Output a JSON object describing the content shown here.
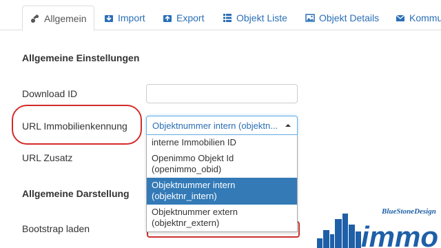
{
  "tabs": [
    {
      "label": "Allgemein",
      "icon": "wrench-icon"
    },
    {
      "label": "Import",
      "icon": "import-icon"
    },
    {
      "label": "Export",
      "icon": "export-icon"
    },
    {
      "label": "Objekt Liste",
      "icon": "list-icon"
    },
    {
      "label": "Objekt Details",
      "icon": "picture-icon"
    },
    {
      "label": "Kommu",
      "icon": "envelope-icon"
    }
  ],
  "sections": {
    "general_settings": "Allgemeine Einstellungen",
    "general_display": "Allgemeine Darstellung"
  },
  "fields": {
    "download_id_label": "Download ID",
    "download_id_value": "",
    "url_label": "URL Immobilienkennung",
    "url_selected": "Objektnummer intern (objektn...",
    "url_suffix_label": "URL Zusatz",
    "bootstrap_label": "Bootstrap laden"
  },
  "dropdown_options": [
    {
      "line1": "interne Immobilien ID",
      "line2": ""
    },
    {
      "line1": "Openimmo Objekt Id",
      "line2": "(openimmo_obid)"
    },
    {
      "line1": "Objektnummer intern",
      "line2": "(objektnr_intern)",
      "selected": true
    },
    {
      "line1": "Objektnummer extern",
      "line2": "(objektnr_extern)"
    }
  ],
  "logo": {
    "small_text": "BlueStoneDesign",
    "big_text": "immo"
  },
  "colors": {
    "link": "#2a6fb6",
    "selected_bg": "#337ab7",
    "highlight": "#d42a2a",
    "logo_blue": "#1e5fa8"
  }
}
